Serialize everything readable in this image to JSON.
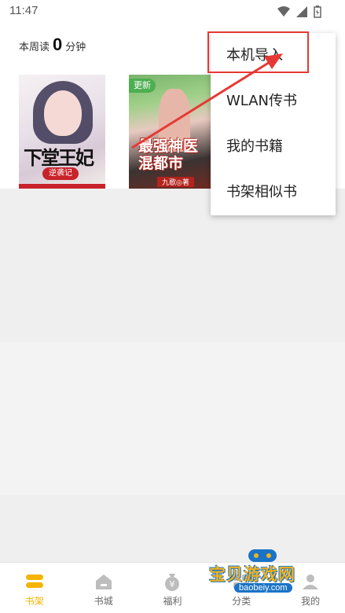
{
  "status_bar": {
    "time": "11:47"
  },
  "reading_stats": {
    "prefix": "本周读",
    "minutes": "0",
    "suffix": "分钟"
  },
  "books": [
    {
      "title": "下堂王妃",
      "subtitle": "逆袭记"
    },
    {
      "badge": "更新",
      "title": "最强神医混都市",
      "author": "九歌◎著"
    }
  ],
  "popup_menu": {
    "items": [
      "本机导入",
      "WLAN传书",
      "我的书籍",
      "书架相似书"
    ]
  },
  "tab_bar": {
    "tabs": [
      {
        "label": "书架",
        "icon": "bookshelf-icon",
        "active": true
      },
      {
        "label": "书城",
        "icon": "bookstore-icon",
        "active": false
      },
      {
        "label": "福利",
        "icon": "welfare-icon",
        "active": false
      },
      {
        "label": "分类",
        "icon": "category-icon",
        "active": false
      },
      {
        "label": "我的",
        "icon": "profile-icon",
        "active": false
      }
    ]
  },
  "watermark": {
    "text": "宝贝游戏网",
    "url": "baobeiy.com"
  },
  "colors": {
    "accent": "#f5b400",
    "annotation": "#e53935",
    "badge": "#4caf50"
  }
}
